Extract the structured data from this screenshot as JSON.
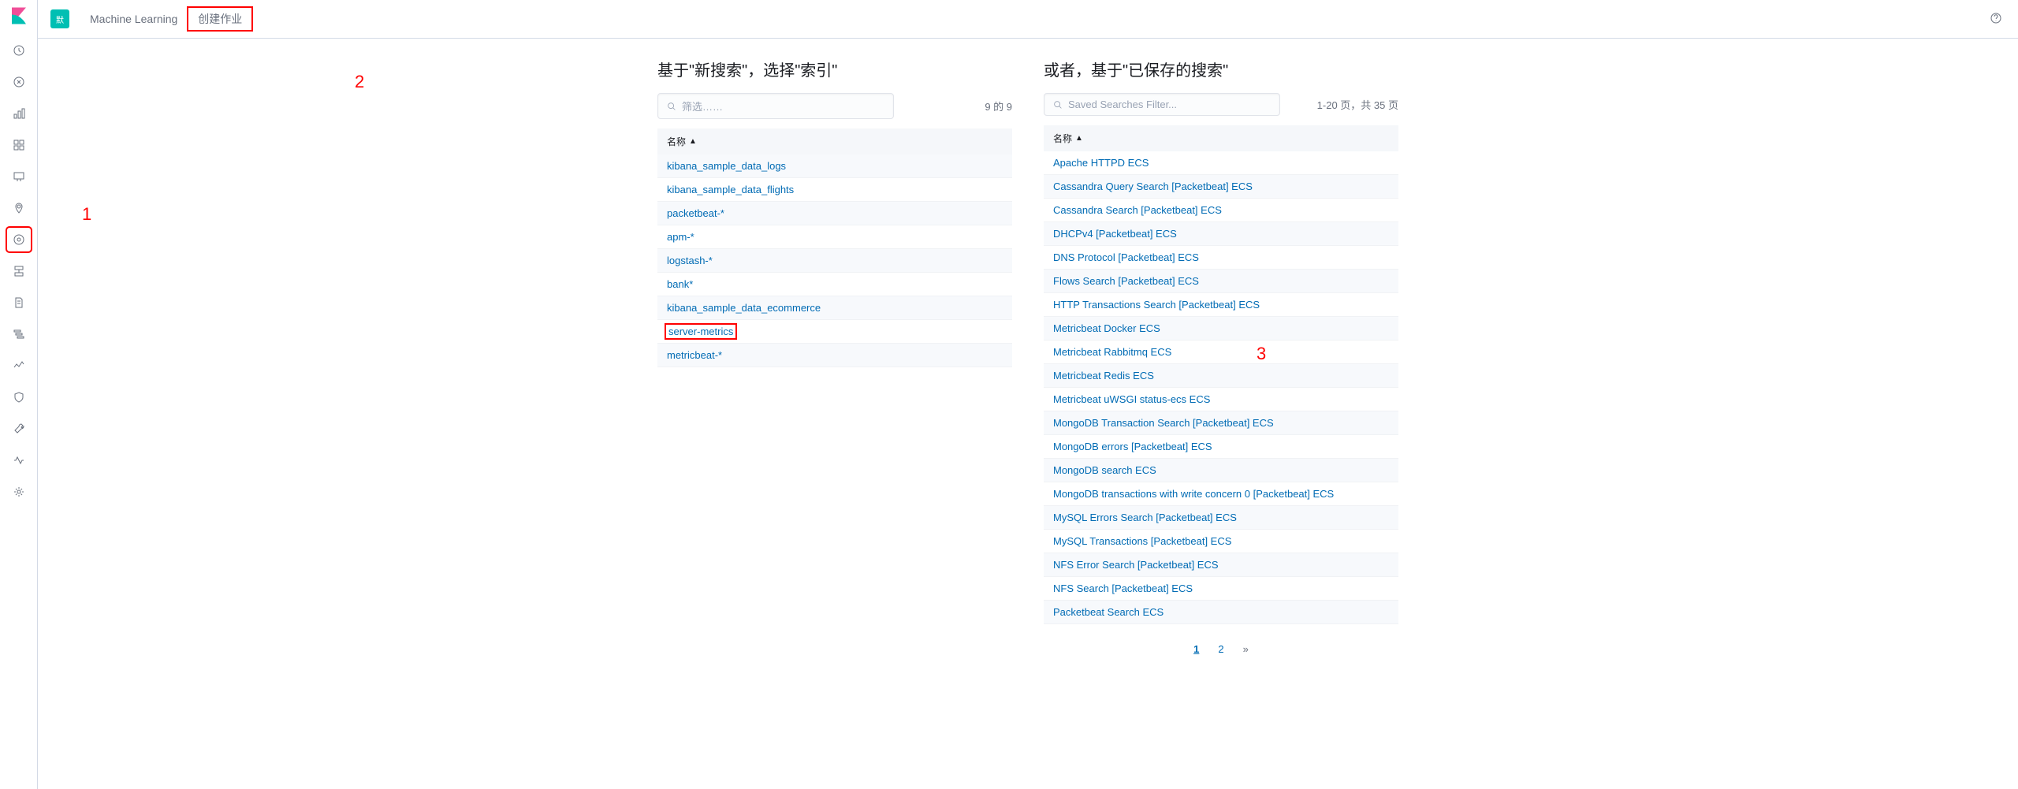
{
  "header": {
    "app_badge": "默",
    "breadcrumb_app": "Machine Learning",
    "breadcrumb_page": "创建作业"
  },
  "left": {
    "title": "基于\"新搜索\"，选择\"索引\"",
    "filter_placeholder": "筛选……",
    "count": "9 的 9",
    "column_header": "名称",
    "items": [
      "kibana_sample_data_logs",
      "kibana_sample_data_flights",
      "packetbeat-*",
      "apm-*",
      "logstash-*",
      "bank*",
      "kibana_sample_data_ecommerce",
      "server-metrics",
      "metricbeat-*"
    ]
  },
  "right": {
    "title": "或者，基于\"已保存的搜索\"",
    "filter_placeholder": "Saved Searches Filter...",
    "count": "1-20 页，共 35 页",
    "column_header": "名称",
    "items": [
      "Apache HTTPD ECS",
      "Cassandra Query Search [Packetbeat] ECS",
      "Cassandra Search [Packetbeat] ECS",
      "DHCPv4 [Packetbeat] ECS",
      "DNS Protocol [Packetbeat] ECS",
      "Flows Search [Packetbeat] ECS",
      "HTTP Transactions Search [Packetbeat] ECS",
      "Metricbeat Docker ECS",
      "Metricbeat Rabbitmq ECS",
      "Metricbeat Redis ECS",
      "Metricbeat uWSGI status-ecs ECS",
      "MongoDB Transaction Search [Packetbeat] ECS",
      "MongoDB errors [Packetbeat] ECS",
      "MongoDB search ECS",
      "MongoDB transactions with write concern 0 [Packetbeat] ECS",
      "MySQL Errors Search [Packetbeat] ECS",
      "MySQL Transactions [Packetbeat] ECS",
      "NFS Error Search [Packetbeat] ECS",
      "NFS Search [Packetbeat] ECS",
      "Packetbeat Search ECS"
    ]
  },
  "pagination": {
    "p1": "1",
    "p2": "2",
    "next": "»"
  },
  "annotations": {
    "a1": "1",
    "a2": "2",
    "a3": "3"
  },
  "watermark": "",
  "sidebar_icons": [
    "recent-icon",
    "discover-icon",
    "visualize-icon",
    "dashboard-icon",
    "canvas-icon",
    "maps-icon",
    "ml-icon",
    "infra-icon",
    "logs-icon",
    "apm-icon",
    "uptime-icon",
    "siem-icon",
    "dev-tools-icon",
    "monitoring-icon",
    "management-icon"
  ]
}
